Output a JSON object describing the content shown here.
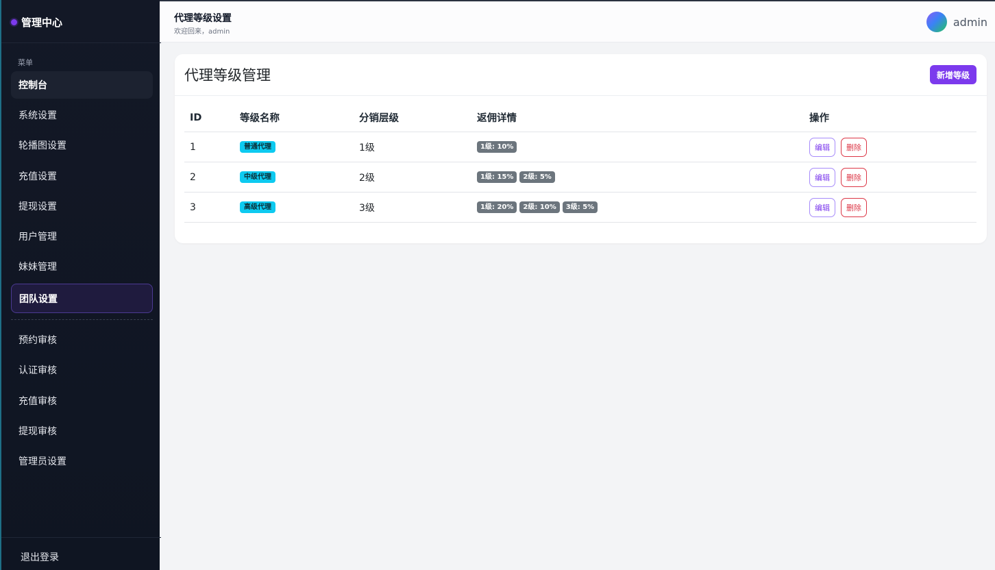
{
  "sidebar": {
    "brand": "管理中心",
    "caption": "菜单",
    "items": [
      {
        "label": "控制台"
      },
      {
        "label": "系统设置"
      },
      {
        "label": "轮播图设置"
      },
      {
        "label": "充值设置"
      },
      {
        "label": "提现设置"
      },
      {
        "label": "用户管理"
      },
      {
        "label": "妹妹管理"
      },
      {
        "label": "团队设置"
      },
      {
        "label": "预约审核"
      },
      {
        "label": "认证审核"
      },
      {
        "label": "充值审核"
      },
      {
        "label": "提现审核"
      },
      {
        "label": "管理员设置"
      }
    ],
    "logout": "退出登录"
  },
  "header": {
    "title": "代理等级设置",
    "subtitle": "欢迎回来，admin",
    "username": "admin"
  },
  "card": {
    "title": "代理等级管理",
    "add_button": "新增等级"
  },
  "table": {
    "columns": [
      "ID",
      "等级名称",
      "分销层级",
      "返佣详情",
      "操作"
    ],
    "rows": [
      {
        "id": "1",
        "name": "普通代理",
        "level": "1级",
        "commissions": [
          "1级: 10%"
        ],
        "edit": "编辑",
        "delete": "删除"
      },
      {
        "id": "2",
        "name": "中级代理",
        "level": "2级",
        "commissions": [
          "1级: 15%",
          "2级: 5%"
        ],
        "edit": "编辑",
        "delete": "删除"
      },
      {
        "id": "3",
        "name": "高级代理",
        "level": "3级",
        "commissions": [
          "1级: 20%",
          "2级: 10%",
          "3级: 5%"
        ],
        "edit": "编辑",
        "delete": "删除"
      }
    ]
  },
  "colors": {
    "accent": "#7c3aed",
    "level_badge": "#0dcaf0",
    "commission_badge": "#6c757d",
    "danger": "#dc3545",
    "sidebar_bg": "#131826"
  }
}
